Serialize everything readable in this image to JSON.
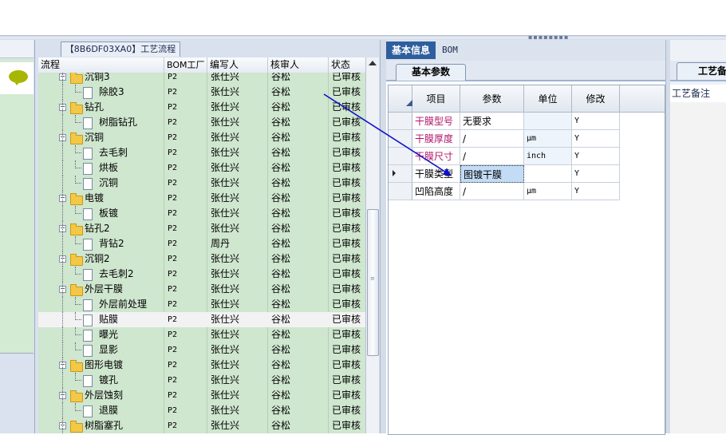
{
  "tree_panel": {
    "title": "【8B6DF03XA0】工艺流程",
    "columns": [
      "流程",
      "BOM工厂",
      "编写人",
      "核审人",
      "状态"
    ],
    "rows": [
      {
        "level": 0,
        "kind": "folder",
        "name": "沉铜3",
        "bom": "P2",
        "writer": "张仕兴",
        "reviewer": "谷松",
        "status": "已审核"
      },
      {
        "level": 1,
        "kind": "doc",
        "name": "除胶3",
        "bom": "P2",
        "writer": "张仕兴",
        "reviewer": "谷松",
        "status": "已审核"
      },
      {
        "level": 0,
        "kind": "folder",
        "name": "钻孔",
        "bom": "P2",
        "writer": "张仕兴",
        "reviewer": "谷松",
        "status": "已审核"
      },
      {
        "level": 1,
        "kind": "doc",
        "name": "树脂钻孔",
        "bom": "P2",
        "writer": "张仕兴",
        "reviewer": "谷松",
        "status": "已审核"
      },
      {
        "level": 0,
        "kind": "folder",
        "name": "沉铜",
        "bom": "P2",
        "writer": "张仕兴",
        "reviewer": "谷松",
        "status": "已审核"
      },
      {
        "level": 1,
        "kind": "doc",
        "name": "去毛刺",
        "bom": "P2",
        "writer": "张仕兴",
        "reviewer": "谷松",
        "status": "已审核"
      },
      {
        "level": 1,
        "kind": "doc",
        "name": "烘板",
        "bom": "P2",
        "writer": "张仕兴",
        "reviewer": "谷松",
        "status": "已审核"
      },
      {
        "level": 1,
        "kind": "doc",
        "name": "沉铜",
        "bom": "P2",
        "writer": "张仕兴",
        "reviewer": "谷松",
        "status": "已审核"
      },
      {
        "level": 0,
        "kind": "folder",
        "name": "电镀",
        "bom": "P2",
        "writer": "张仕兴",
        "reviewer": "谷松",
        "status": "已审核"
      },
      {
        "level": 1,
        "kind": "doc",
        "name": "板镀",
        "bom": "P2",
        "writer": "张仕兴",
        "reviewer": "谷松",
        "status": "已审核"
      },
      {
        "level": 0,
        "kind": "folder",
        "name": "钻孔2",
        "bom": "P2",
        "writer": "张仕兴",
        "reviewer": "谷松",
        "status": "已审核"
      },
      {
        "level": 1,
        "kind": "doc",
        "name": "背钻2",
        "bom": "P2",
        "writer": "周丹",
        "reviewer": "谷松",
        "status": "已审核"
      },
      {
        "level": 0,
        "kind": "folder",
        "name": "沉铜2",
        "bom": "P2",
        "writer": "张仕兴",
        "reviewer": "谷松",
        "status": "已审核"
      },
      {
        "level": 1,
        "kind": "doc",
        "name": "去毛刺2",
        "bom": "P2",
        "writer": "张仕兴",
        "reviewer": "谷松",
        "status": "已审核"
      },
      {
        "level": 0,
        "kind": "folder",
        "name": "外层干膜",
        "bom": "P2",
        "writer": "张仕兴",
        "reviewer": "谷松",
        "status": "已审核"
      },
      {
        "level": 1,
        "kind": "doc",
        "name": "外层前处理",
        "bom": "P2",
        "writer": "张仕兴",
        "reviewer": "谷松",
        "status": "已审核"
      },
      {
        "level": 1,
        "kind": "doc",
        "name": "贴膜",
        "bom": "P2",
        "writer": "张仕兴",
        "reviewer": "谷松",
        "status": "已审核",
        "selected": true
      },
      {
        "level": 1,
        "kind": "doc",
        "name": "曝光",
        "bom": "P2",
        "writer": "张仕兴",
        "reviewer": "谷松",
        "status": "已审核"
      },
      {
        "level": 1,
        "kind": "doc",
        "name": "显影",
        "bom": "P2",
        "writer": "张仕兴",
        "reviewer": "谷松",
        "status": "已审核"
      },
      {
        "level": 0,
        "kind": "folder",
        "name": "图形电镀",
        "bom": "P2",
        "writer": "张仕兴",
        "reviewer": "谷松",
        "status": "已审核"
      },
      {
        "level": 1,
        "kind": "doc",
        "name": "镀孔",
        "bom": "P2",
        "writer": "张仕兴",
        "reviewer": "谷松",
        "status": "已审核"
      },
      {
        "level": 0,
        "kind": "folder",
        "name": "外层蚀刻",
        "bom": "P2",
        "writer": "张仕兴",
        "reviewer": "谷松",
        "status": "已审核"
      },
      {
        "level": 1,
        "kind": "doc",
        "name": "退膜",
        "bom": "P2",
        "writer": "张仕兴",
        "reviewer": "谷松",
        "status": "已审核"
      },
      {
        "level": 0,
        "kind": "folder",
        "name": "树脂塞孔",
        "bom": "P2",
        "writer": "张仕兴",
        "reviewer": "谷松",
        "status": "已审核"
      }
    ]
  },
  "right_tabs": {
    "basic": "基本信息",
    "bom": "BOM"
  },
  "sub_tab": "基本参数",
  "param_grid": {
    "headers": [
      "项目",
      "参数",
      "单位",
      "修改"
    ],
    "rows": [
      {
        "item": "干膜型号",
        "value": "无要求",
        "unit": "",
        "modify": "Y",
        "highlight": true
      },
      {
        "item": "干膜厚度",
        "value": "/",
        "unit": "μm",
        "modify": "Y",
        "highlight": true
      },
      {
        "item": "干膜尺寸",
        "value": "/",
        "unit": "inch",
        "modify": "Y",
        "highlight": true
      },
      {
        "item": "干膜类型",
        "value": "图镀干膜",
        "unit": "",
        "modify": "Y",
        "highlight": false,
        "current": true
      },
      {
        "item": "凹陷高度",
        "value": "/",
        "unit": "μm",
        "modify": "Y",
        "highlight": false
      }
    ]
  },
  "far_pane": {
    "tab": "工艺备",
    "header": "工艺备注"
  },
  "colors": {
    "accent": "#2e5e9e",
    "tree_bg": "#cfe6cf",
    "highlight_text": "#b0166b",
    "arrow": "#1010c8"
  }
}
